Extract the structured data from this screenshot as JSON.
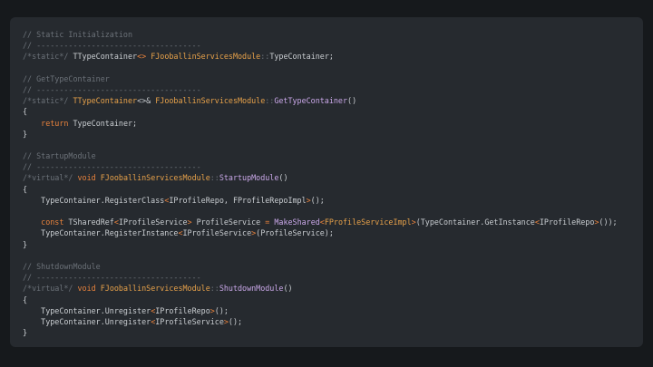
{
  "code": {
    "lines": [
      [
        {
          "t": "// Static Initialization",
          "k": "comment"
        }
      ],
      [
        {
          "t": "// ------------------------------------",
          "k": "comment"
        }
      ],
      [
        {
          "t": "/*static*/ ",
          "k": "comment"
        },
        {
          "t": "TTypeContainer",
          "k": "plain"
        },
        {
          "t": "<> ",
          "k": "op"
        },
        {
          "t": "FJooballinServicesModule",
          "k": "type"
        },
        {
          "t": "::",
          "k": "comment"
        },
        {
          "t": "TypeContainer;",
          "k": "plain"
        }
      ],
      [],
      [
        {
          "t": "// GetTypeContainer",
          "k": "comment"
        }
      ],
      [
        {
          "t": "// ------------------------------------",
          "k": "comment"
        }
      ],
      [
        {
          "t": "/*static*/ ",
          "k": "comment"
        },
        {
          "t": "TTypeContainer",
          "k": "type"
        },
        {
          "t": "<>& ",
          "k": "plain"
        },
        {
          "t": "FJooballinServicesModule",
          "k": "type"
        },
        {
          "t": "::",
          "k": "comment"
        },
        {
          "t": "GetTypeContainer",
          "k": "func"
        },
        {
          "t": "()",
          "k": "plain"
        }
      ],
      [
        {
          "t": "{",
          "k": "plain"
        }
      ],
      [
        {
          "t": "    ",
          "k": "plain"
        },
        {
          "t": "return",
          "k": "keyword"
        },
        {
          "t": " TypeContainer;",
          "k": "plain"
        }
      ],
      [
        {
          "t": "}",
          "k": "plain"
        }
      ],
      [],
      [
        {
          "t": "// StartupModule",
          "k": "comment"
        }
      ],
      [
        {
          "t": "// ------------------------------------",
          "k": "comment"
        }
      ],
      [
        {
          "t": "/*virtual*/ ",
          "k": "comment"
        },
        {
          "t": "void",
          "k": "keyword"
        },
        {
          "t": " ",
          "k": "plain"
        },
        {
          "t": "FJooballinServicesModule",
          "k": "type"
        },
        {
          "t": "::",
          "k": "comment"
        },
        {
          "t": "StartupModule",
          "k": "func"
        },
        {
          "t": "()",
          "k": "plain"
        }
      ],
      [
        {
          "t": "{",
          "k": "plain"
        }
      ],
      [
        {
          "t": "    TypeContainer.RegisterClass",
          "k": "plain"
        },
        {
          "t": "<",
          "k": "op"
        },
        {
          "t": "IProfileRepo, FProfileRepoImpl",
          "k": "plain"
        },
        {
          "t": ">",
          "k": "op"
        },
        {
          "t": "();",
          "k": "plain"
        }
      ],
      [],
      [
        {
          "t": "    ",
          "k": "plain"
        },
        {
          "t": "const",
          "k": "keyword"
        },
        {
          "t": " TSharedRef",
          "k": "plain"
        },
        {
          "t": "<",
          "k": "op"
        },
        {
          "t": "IProfileService",
          "k": "plain"
        },
        {
          "t": ">",
          "k": "op"
        },
        {
          "t": " ProfileService ",
          "k": "plain"
        },
        {
          "t": "=",
          "k": "op"
        },
        {
          "t": " ",
          "k": "plain"
        },
        {
          "t": "MakeShared",
          "k": "func"
        },
        {
          "t": "<",
          "k": "op"
        },
        {
          "t": "FProfileServiceImpl",
          "k": "type"
        },
        {
          "t": ">",
          "k": "op"
        },
        {
          "t": "(TypeContainer.GetInstance",
          "k": "plain"
        },
        {
          "t": "<",
          "k": "op"
        },
        {
          "t": "IProfileRepo",
          "k": "plain"
        },
        {
          "t": ">",
          "k": "op"
        },
        {
          "t": "());",
          "k": "plain"
        }
      ],
      [
        {
          "t": "    TypeContainer.RegisterInstance",
          "k": "plain"
        },
        {
          "t": "<",
          "k": "op"
        },
        {
          "t": "IProfileService",
          "k": "plain"
        },
        {
          "t": ">",
          "k": "op"
        },
        {
          "t": "(ProfileService);",
          "k": "plain"
        }
      ],
      [
        {
          "t": "}",
          "k": "plain"
        }
      ],
      [],
      [
        {
          "t": "// ShutdownModule",
          "k": "comment"
        }
      ],
      [
        {
          "t": "// ------------------------------------",
          "k": "comment"
        }
      ],
      [
        {
          "t": "/*virtual*/ ",
          "k": "comment"
        },
        {
          "t": "void",
          "k": "keyword"
        },
        {
          "t": " ",
          "k": "plain"
        },
        {
          "t": "FJooballinServicesModule",
          "k": "type"
        },
        {
          "t": "::",
          "k": "comment"
        },
        {
          "t": "ShutdownModule",
          "k": "func"
        },
        {
          "t": "()",
          "k": "plain"
        }
      ],
      [
        {
          "t": "{",
          "k": "plain"
        }
      ],
      [
        {
          "t": "    TypeContainer.Unregister",
          "k": "plain"
        },
        {
          "t": "<",
          "k": "op"
        },
        {
          "t": "IProfileRepo",
          "k": "plain"
        },
        {
          "t": ">",
          "k": "op"
        },
        {
          "t": "();",
          "k": "plain"
        }
      ],
      [
        {
          "t": "    TypeContainer.Unregister",
          "k": "plain"
        },
        {
          "t": "<",
          "k": "op"
        },
        {
          "t": "IProfileService",
          "k": "plain"
        },
        {
          "t": ">",
          "k": "op"
        },
        {
          "t": "();",
          "k": "plain"
        }
      ],
      [
        {
          "t": "}",
          "k": "plain"
        }
      ]
    ]
  }
}
